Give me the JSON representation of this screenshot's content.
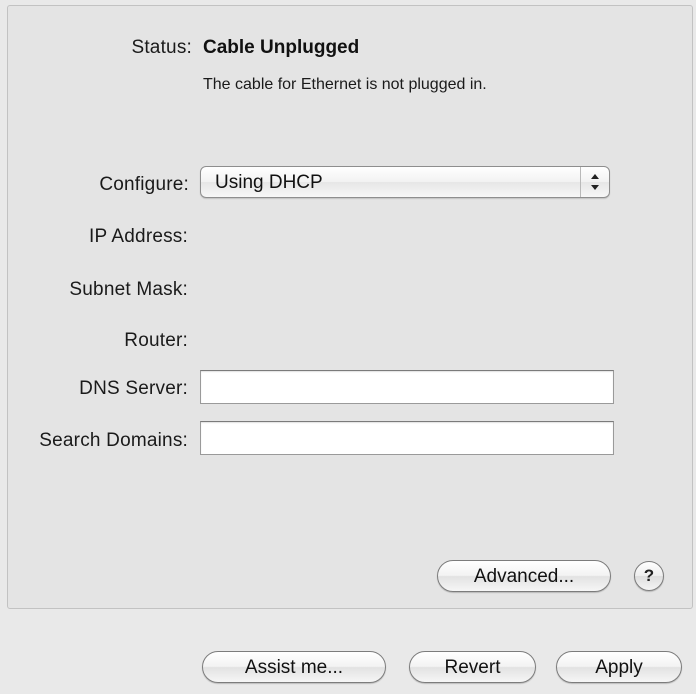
{
  "status": {
    "label": "Status:",
    "value": "Cable Unplugged",
    "description": "The cable for Ethernet is not plugged in."
  },
  "configure": {
    "label": "Configure:",
    "selected": "Using DHCP"
  },
  "fields": {
    "ip_address_label": "IP Address:",
    "subnet_mask_label": "Subnet Mask:",
    "router_label": "Router:",
    "dns_server_label": "DNS Server:",
    "dns_server_value": "",
    "search_domains_label": "Search Domains:",
    "search_domains_value": ""
  },
  "buttons": {
    "advanced": "Advanced...",
    "help": "?",
    "assist": "Assist me...",
    "revert": "Revert",
    "apply": "Apply"
  },
  "icons": {
    "popup_arrows": "updown-arrows-icon"
  }
}
